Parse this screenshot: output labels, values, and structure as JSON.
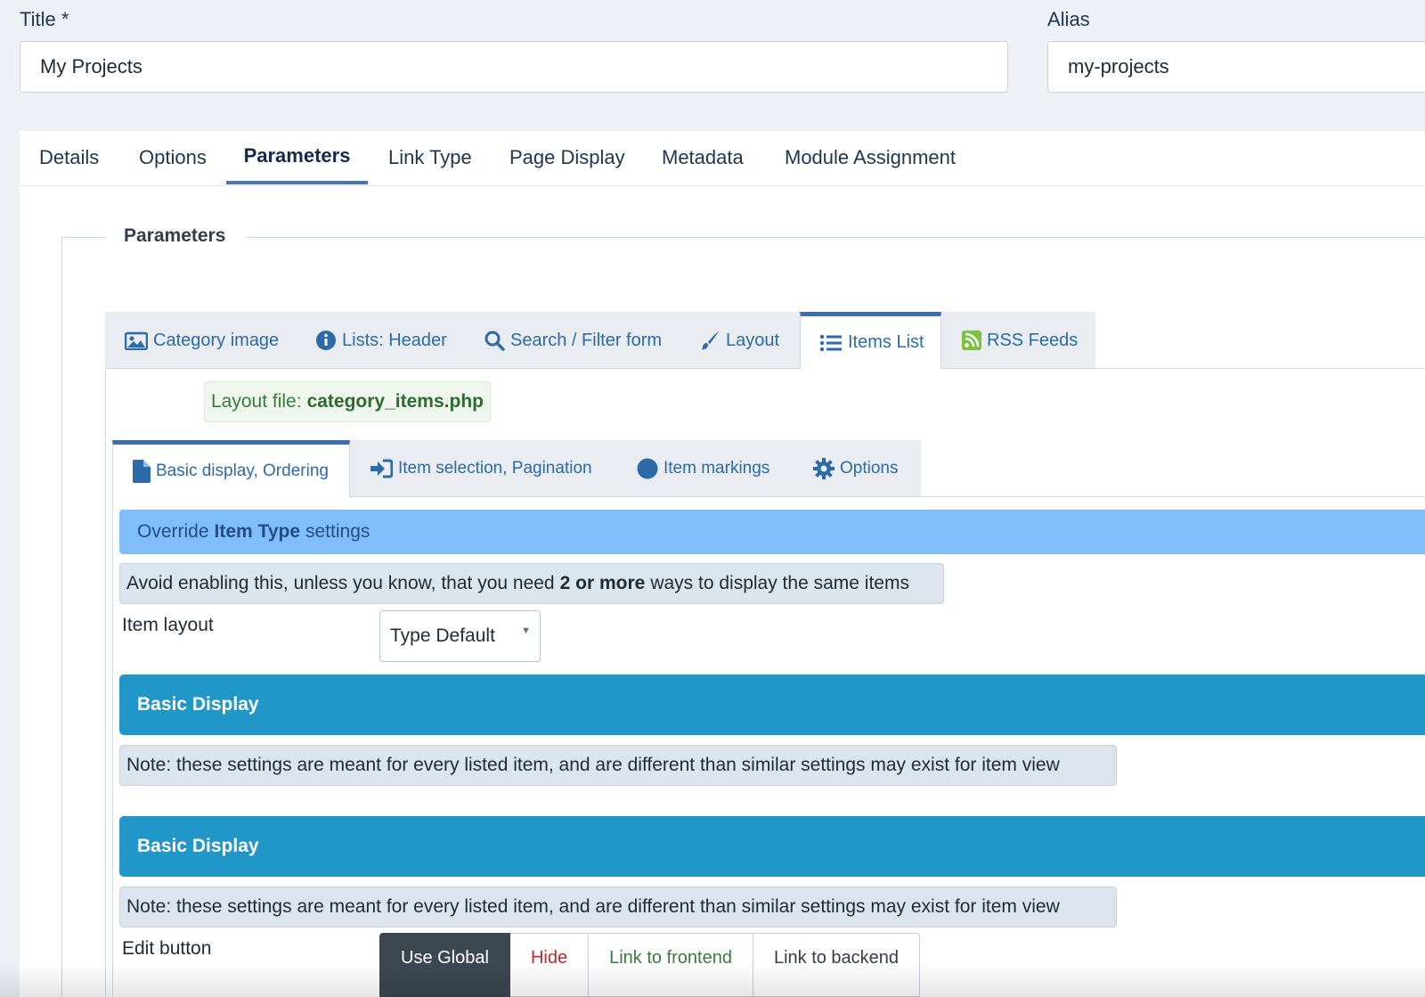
{
  "form": {
    "title_label": "Title *",
    "title_value": "My Projects",
    "alias_label": "Alias",
    "alias_value": "my-projects"
  },
  "top_tabs": [
    {
      "label": "Details"
    },
    {
      "label": "Options"
    },
    {
      "label": "Parameters",
      "active": true
    },
    {
      "label": "Link Type"
    },
    {
      "label": "Page Display"
    },
    {
      "label": "Metadata"
    },
    {
      "label": "Module Assignment"
    }
  ],
  "fieldset": {
    "legend": "Parameters"
  },
  "sub_tabs": [
    {
      "label": "Category image",
      "icon": "image-icon"
    },
    {
      "label": "Lists: Header",
      "icon": "info-icon"
    },
    {
      "label": "Search / Filter form",
      "icon": "search-icon"
    },
    {
      "label": "Layout",
      "icon": "brush-icon"
    },
    {
      "label": "Items List",
      "icon": "list-icon",
      "active": true
    },
    {
      "label": "RSS Feeds",
      "icon": "rss-icon"
    }
  ],
  "layout_file": {
    "prefix": "Layout file:",
    "name": "category_items.php"
  },
  "inner_tabs": [
    {
      "label": "Basic display, Ordering",
      "icon": "file-icon",
      "active": true
    },
    {
      "label": "Item selection, Pagination",
      "icon": "sign-in-icon"
    },
    {
      "label": "Item markings",
      "icon": "circle-icon"
    },
    {
      "label": "Options",
      "icon": "gear-icon"
    }
  ],
  "override": {
    "pre": "Override",
    "bold": "Item Type",
    "post": "settings"
  },
  "avoid_note": {
    "pre": "Avoid enabling this, unless you know, that you need",
    "bold": "2 or more",
    "post": "ways to display the same items"
  },
  "item_layout": {
    "label": "Item layout",
    "value": "Type Default"
  },
  "sections": [
    {
      "title": "Basic Display",
      "note": "Note: these settings are meant for every listed item, and are different than similar settings may exist for item view"
    },
    {
      "title": "Basic Display",
      "note": "Note: these settings are meant for every listed item, and are different than similar settings may exist for item view"
    }
  ],
  "edit_button": {
    "label": "Edit button",
    "options": [
      {
        "label": "Use Global",
        "selected": true
      },
      {
        "label": "Hide"
      },
      {
        "label": "Link to frontend"
      },
      {
        "label": "Link to backend"
      }
    ]
  },
  "colors": {
    "accent": "#3d6fb0",
    "section_bar": "#2196c9",
    "override_bar": "#7fbefa",
    "hide_text": "#c0262d",
    "frontend_text": "#3a7a3a",
    "selected_button": "#3d4751"
  }
}
